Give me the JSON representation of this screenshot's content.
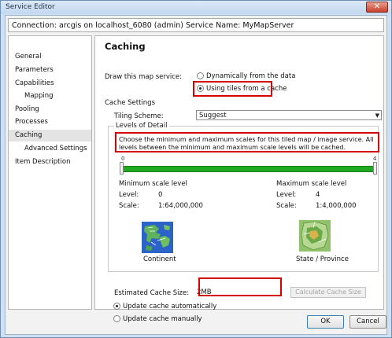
{
  "window": {
    "title": "Service Editor",
    "close_glyph": "✕"
  },
  "connection": {
    "text": "Connection: arcgis on localhost_6080 (admin)    Service Name: MyMapServer"
  },
  "sidebar": {
    "items": [
      {
        "label": "General"
      },
      {
        "label": "Parameters"
      },
      {
        "label": "Capabilities"
      },
      {
        "label": "Mapping"
      },
      {
        "label": "Pooling"
      },
      {
        "label": "Processes"
      },
      {
        "label": "Caching"
      },
      {
        "label": "Advanced Settings"
      },
      {
        "label": "Item Description"
      }
    ],
    "selected": "Caching"
  },
  "caching": {
    "heading": "Caching",
    "draw_label": "Draw this map service:",
    "draw_options": [
      {
        "label": "Dynamically from the data",
        "selected": false
      },
      {
        "label": "Using tiles from a cache",
        "selected": true
      }
    ],
    "cache_settings_label": "Cache Settings",
    "tiling_scheme_label": "Tiling Scheme:",
    "tiling_scheme_value": "Suggest",
    "lod_label": "Levels of Detail",
    "lod_description": "Choose the minimum and maximum scales for this tiled map / image service. All levels between the minimum and maximum scale levels will be cached.",
    "slider": {
      "min": 0,
      "max": 4,
      "ticks": [
        "0",
        "4"
      ]
    },
    "minimum": {
      "title": "Minimum scale level",
      "level_label": "Level:",
      "level_value": "0",
      "scale_label": "Scale:",
      "scale_value": "1:64,000,000",
      "image_label": "Continent",
      "icon": "continent-map-icon"
    },
    "maximum": {
      "title": "Maximum scale level",
      "level_label": "Level:",
      "level_value": "4",
      "scale_label": "Scale:",
      "scale_value": "1:4,000,000",
      "image_label": "State / Province",
      "icon": "state-map-icon"
    },
    "estimated_size_label": "Estimated Cache Size:",
    "estimated_size_value": "2MB",
    "calculate_button": "Calculate Cache Size",
    "update_options": [
      {
        "label": "Update cache automatically",
        "selected": true
      },
      {
        "label": "Update cache manually",
        "selected": false
      }
    ]
  },
  "footer": {
    "ok_label": "OK",
    "cancel_label": "Cancel"
  },
  "colors": {
    "highlight": "#d40000",
    "slider_fill": "#1faa1f"
  }
}
